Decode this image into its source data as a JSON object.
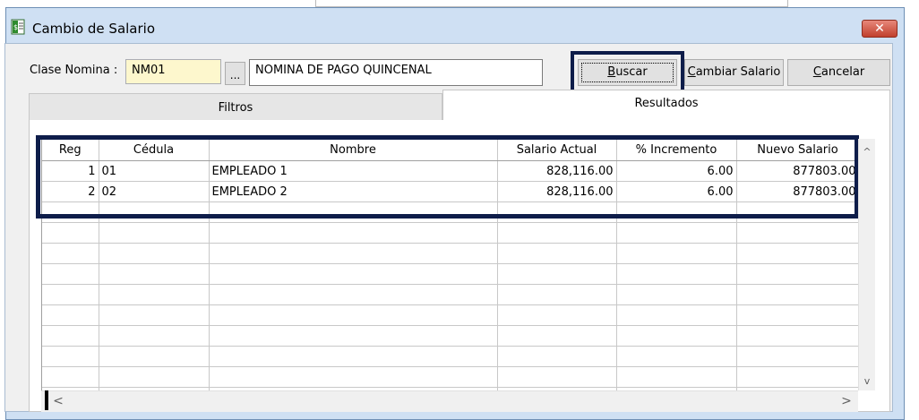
{
  "window": {
    "title": "Cambio de Salario",
    "close_label": "✕"
  },
  "form": {
    "clase_label": "Clase Nomina :",
    "clase_code": "NM01",
    "ellipsis_label": "...",
    "clase_name": "NOMINA DE PAGO QUINCENAL"
  },
  "buttons": {
    "buscar": {
      "underline": "B",
      "rest": "uscar"
    },
    "cambiar": {
      "underline": "C",
      "rest": "ambiar Salario"
    },
    "cancelar": {
      "underline": "C",
      "rest": "ancelar"
    }
  },
  "tabs": {
    "filtros": "Filtros",
    "resultados": "Resultados"
  },
  "grid": {
    "columns": [
      "Reg",
      "Cédula",
      "Nombre",
      "Salario Actual",
      "% Incremento",
      "Nuevo Salario"
    ],
    "rows": [
      [
        "1",
        "01",
        "EMPLEADO 1",
        "828,116.00",
        "6.00",
        "877803.00"
      ],
      [
        "2",
        "02",
        "EMPLEADO 2",
        "828,116.00",
        "6.00",
        "877803.00"
      ]
    ],
    "empty_rows": 10
  },
  "scroll": {
    "up": "^",
    "down": "v",
    "left": "<",
    "right": ">"
  }
}
